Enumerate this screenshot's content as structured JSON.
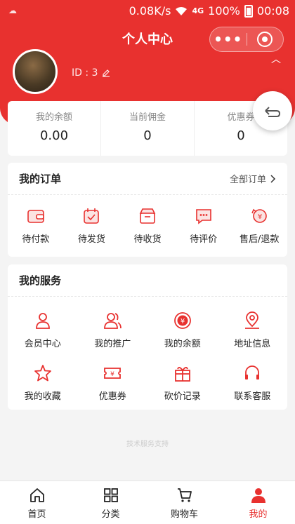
{
  "status_bar": {
    "speed": "0.08K/s",
    "signal": "4G",
    "battery": "100%",
    "time": "00:08"
  },
  "nav": {
    "title": "个人中心",
    "more_icon": "more-dots-icon",
    "close_icon": "capsule-target-icon"
  },
  "user": {
    "id_label": "ID : 3"
  },
  "stats": [
    {
      "label": "我的余额",
      "value": "0.00"
    },
    {
      "label": "当前佣金",
      "value": "0"
    },
    {
      "label": "优惠券",
      "value": "0"
    }
  ],
  "orders": {
    "title": "我的订单",
    "all_label": "全部订单",
    "items": [
      {
        "label": "待付款",
        "icon": "wallet-icon"
      },
      {
        "label": "待发货",
        "icon": "calendar-check-icon"
      },
      {
        "label": "待收货",
        "icon": "box-icon"
      },
      {
        "label": "待评价",
        "icon": "chat-icon"
      },
      {
        "label": "售后/退款",
        "icon": "refund-icon"
      }
    ]
  },
  "services": {
    "title": "我的服务",
    "items": [
      {
        "label": "会员中心",
        "icon": "user-icon"
      },
      {
        "label": "我的推广",
        "icon": "users-icon"
      },
      {
        "label": "我的余额",
        "icon": "yen-circle-icon"
      },
      {
        "label": "地址信息",
        "icon": "location-icon"
      },
      {
        "label": "我的收藏",
        "icon": "star-icon"
      },
      {
        "label": "优惠券",
        "icon": "coupon-icon"
      },
      {
        "label": "砍价记录",
        "icon": "gift-icon"
      },
      {
        "label": "联系客服",
        "icon": "headset-icon"
      }
    ]
  },
  "footer": {
    "text": "技术服务支持"
  },
  "tabbar": [
    {
      "label": "首页",
      "icon": "home-icon"
    },
    {
      "label": "分类",
      "icon": "grid-icon"
    },
    {
      "label": "购物车",
      "icon": "cart-icon"
    },
    {
      "label": "我的",
      "icon": "person-icon",
      "active": true
    }
  ],
  "colors": {
    "brand": "#e8312f",
    "background": "#f4f4f4"
  }
}
